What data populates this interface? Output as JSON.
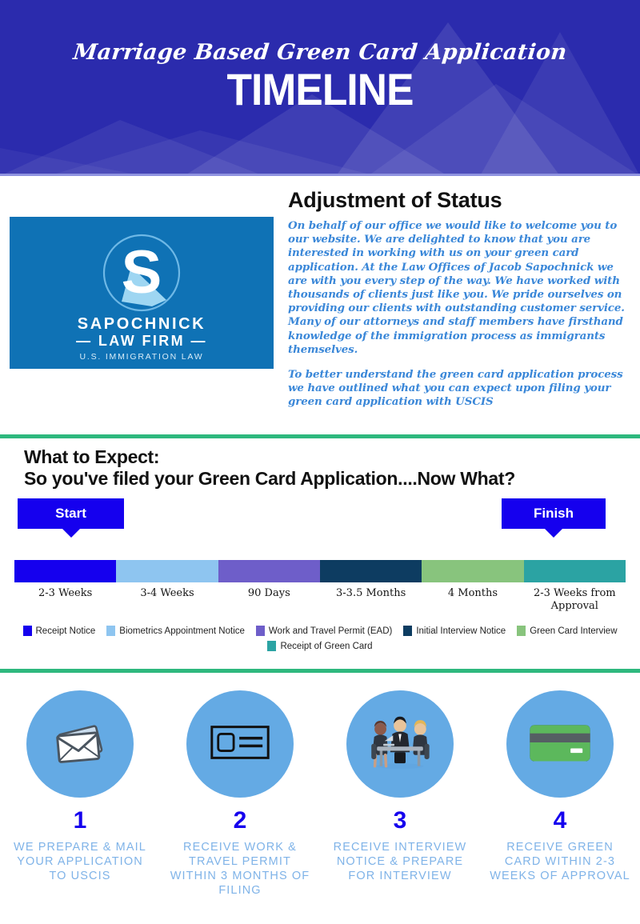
{
  "header": {
    "script_line": "Marriage Based Green Card Application",
    "title": "TIMELINE",
    "background_color": "#2b2bad"
  },
  "intro": {
    "heading": "Adjustment of Status",
    "paragraph_1": "On behalf of our office we would like to welcome you to our website. We are delighted to know that you are interested in working with us on your green card application. At the Law Offices of Jacob Sapochnick we are with you every step of the way. We have worked with thousands of clients just like you. We pride ourselves on providing our clients with outstanding customer service. Many of our attorneys and staff members have firsthand knowledge of the immigration process as immigrants themselves.",
    "paragraph_2": "To better understand the green card application process we have outlined what you can expect upon filing your green card application with USCIS",
    "text_color": "#3a87d8"
  },
  "logo": {
    "monogram": "S",
    "name": "SAPOCHNICK",
    "subtitle": "— LAW FIRM —",
    "tagline": "U.S. IMMIGRATION LAW",
    "background_color": "#0f72b5"
  },
  "expect": {
    "heading_line_1": "What to Expect:",
    "heading_line_2": "So you've filed your Green Card Application....Now What?",
    "start_label": "Start",
    "finish_label": "Finish",
    "flag_color": "#1500ee",
    "divider_color": "#2eb87e"
  },
  "chart_data": {
    "type": "bar",
    "title": "Marriage Based Green Card Application Timeline",
    "orientation": "horizontal-stacked",
    "xlabel": "",
    "ylabel": "",
    "grid": false,
    "legend_position": "bottom",
    "start_marker": "Start",
    "finish_marker": "Finish",
    "categories": [
      "Receipt Notice",
      "Biometrics Appointment Notice",
      "Work and Travel Permit (EAD)",
      "Initial Interview Notice",
      "Green Card Interview",
      "Receipt of Green Card"
    ],
    "tick_labels": [
      "2-3 Weeks",
      "3-4 Weeks",
      "90 Days",
      "3-3.5 Months",
      "4 Months",
      "2-3 Weeks from Approval"
    ],
    "values": [
      1,
      1,
      1,
      1,
      1,
      1
    ],
    "colors": [
      "#1500ee",
      "#8ec5f0",
      "#6e5ec9",
      "#0d3c61",
      "#88c47d",
      "#2ba3a3"
    ],
    "legend": [
      {
        "label": "Receipt Notice",
        "color": "#1500ee"
      },
      {
        "label": "Biometrics Appointment Notice",
        "color": "#8ec5f0"
      },
      {
        "label": "Work and Travel Permit (EAD)",
        "color": "#6e5ec9"
      },
      {
        "label": "Initial Interview Notice",
        "color": "#0d3c61"
      },
      {
        "label": "Green Card Interview",
        "color": "#88c47d"
      },
      {
        "label": "Receipt of Green Card",
        "color": "#2ba3a3"
      }
    ]
  },
  "steps": [
    {
      "number": "1",
      "icon": "envelope-icon",
      "caption": "WE PREPARE & MAIL YOUR APPLICATION TO USCIS"
    },
    {
      "number": "2",
      "icon": "permit-card-icon",
      "caption": "RECEIVE WORK & TRAVEL PERMIT WITHIN 3 MONTHS OF FILING"
    },
    {
      "number": "3",
      "icon": "interview-meeting-icon",
      "caption": "RECEIVE INTERVIEW NOTICE & PREPARE FOR INTERVIEW"
    },
    {
      "number": "4",
      "icon": "green-card-icon",
      "caption": "RECEIVE GREEN CARD WITHIN 2-3 WEEKS OF APPROVAL"
    }
  ]
}
